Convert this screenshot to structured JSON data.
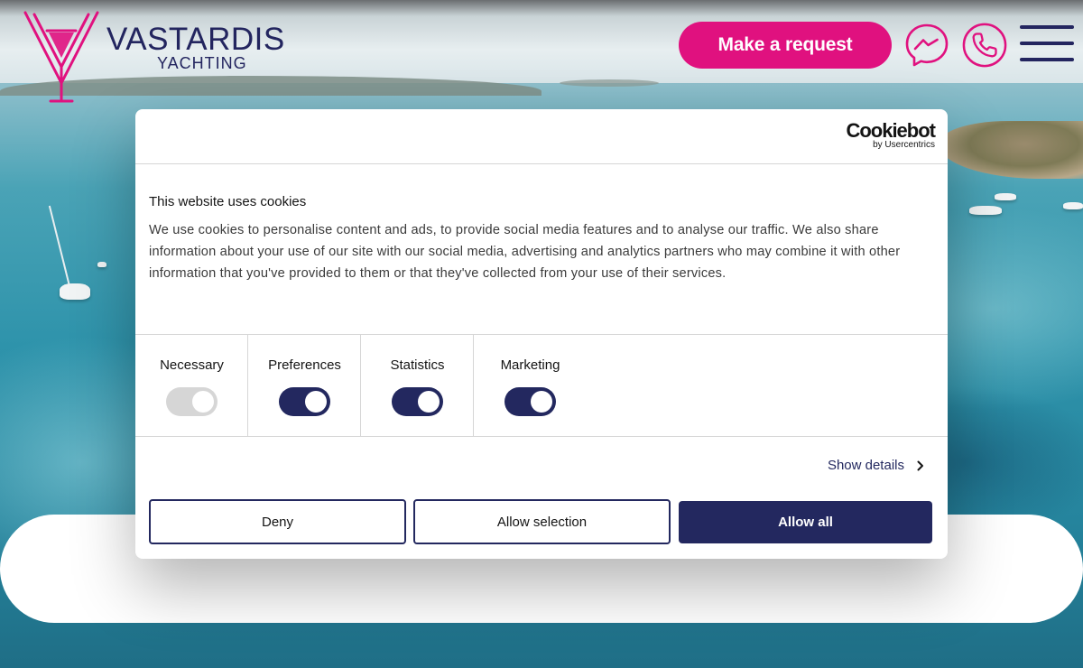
{
  "header": {
    "brand_name": "VASTARDIS",
    "brand_sub": "YACHTING",
    "request_label": "Make a request",
    "icons": {
      "messenger": "messenger-icon",
      "phone": "phone-icon",
      "menu": "hamburger-menu-icon"
    },
    "colors": {
      "accent": "#e0117f",
      "brand": "#23255f"
    }
  },
  "dialog": {
    "provider_name": "Cookiebot",
    "provider_by": "by Usercentrics",
    "title": "This website uses cookies",
    "text": "We use cookies to personalise content and ads, to provide social media features and to analyse our traffic. We also share information about your use of our site with our social media, advertising and analytics partners who may combine it with other information that you've provided to them or that they've collected from your use of their services.",
    "toggles": [
      {
        "label": "Necessary",
        "on": true,
        "disabled": true
      },
      {
        "label": "Preferences",
        "on": true,
        "disabled": false
      },
      {
        "label": "Statistics",
        "on": true,
        "disabled": false
      },
      {
        "label": "Marketing",
        "on": true,
        "disabled": false
      }
    ],
    "show_details_label": "Show details",
    "buttons": {
      "deny": "Deny",
      "allow_selection": "Allow selection",
      "allow_all": "Allow all"
    },
    "colors": {
      "primary": "#23285f"
    }
  }
}
